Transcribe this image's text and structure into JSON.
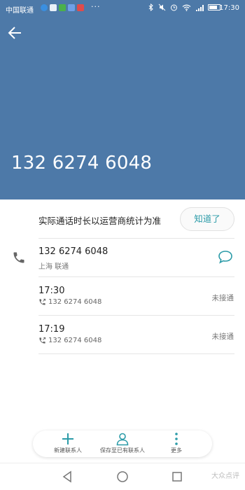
{
  "status_bar": {
    "carrier": "中国联通",
    "more": "···",
    "time": "17:30"
  },
  "header": {
    "phone_number": "132 6274 6048"
  },
  "notice": {
    "text": "实际通话时长以运营商统计为准",
    "ack_label": "知道了"
  },
  "contact": {
    "number": "132 6274 6048",
    "location": "上海 联通"
  },
  "call_log": [
    {
      "time": "17:30",
      "number": "132 6274 6048",
      "status": "未接通"
    },
    {
      "time": "17:19",
      "number": "132 6274 6048",
      "status": "未接通"
    }
  ],
  "bottom_bar": {
    "new_contact": "新建联系人",
    "save_existing": "保存至已有联系人",
    "more": "更多"
  },
  "watermark": "大众点评",
  "colors": {
    "header_bg": "#4d79a8",
    "accent": "#2b9ba8"
  }
}
